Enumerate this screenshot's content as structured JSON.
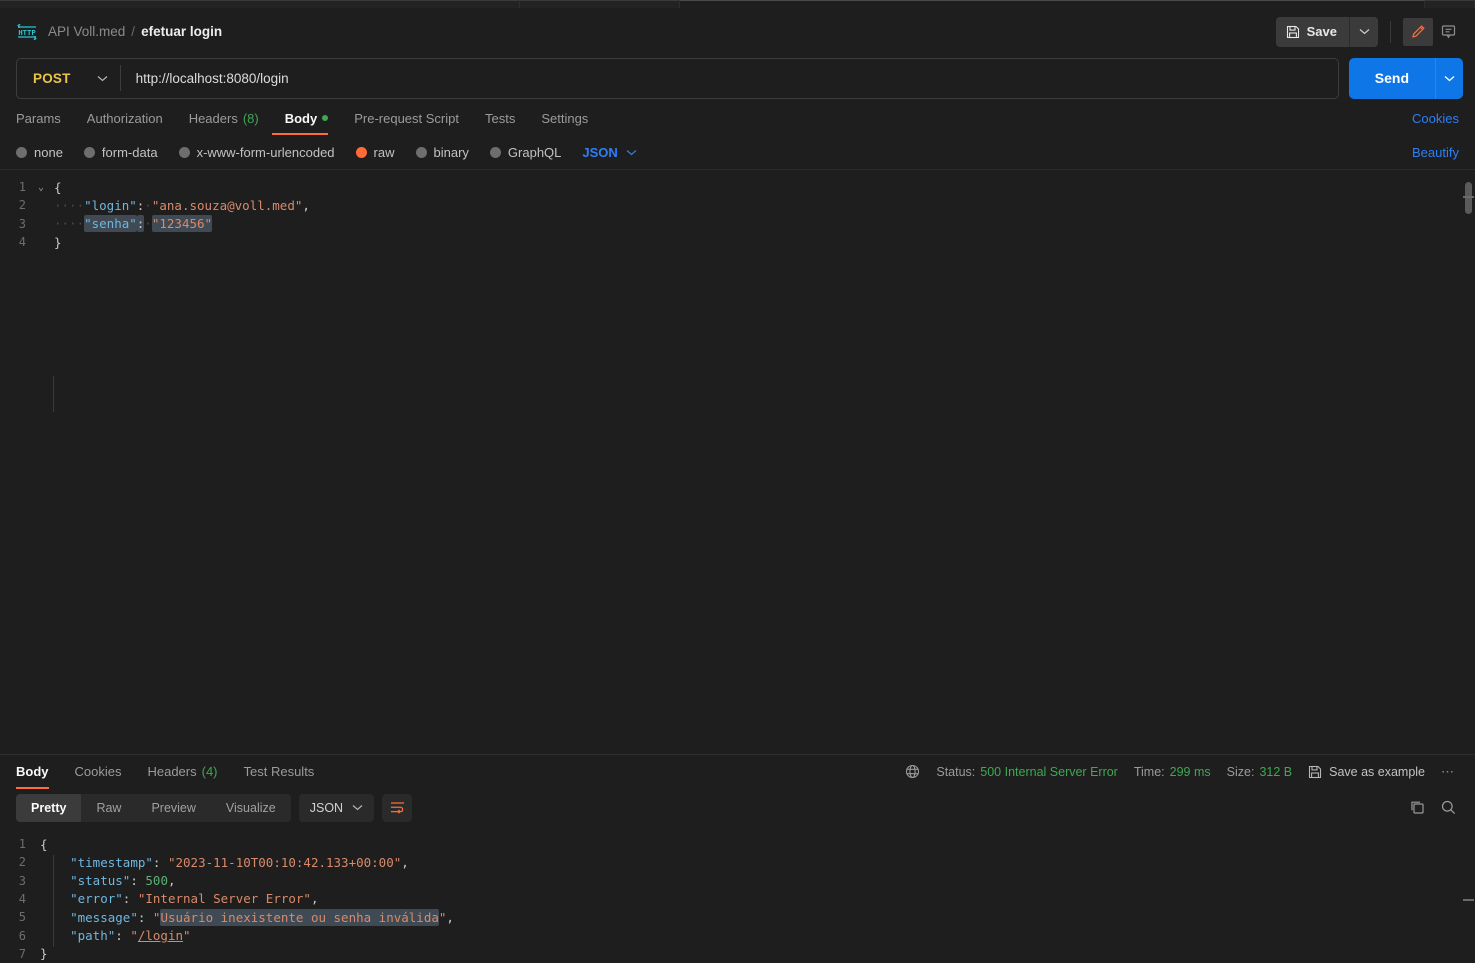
{
  "window": {
    "breadcrumb": {
      "icon": "http-badge-icon",
      "parent": "API Voll.med",
      "separator": "/",
      "current": "efetuar login"
    },
    "save_label": "Save",
    "save_icon": "floppy-disk-icon",
    "save_caret_icon": "chevron-down-icon",
    "edit_icon": "pencil-icon",
    "comment_icon": "comment-icon"
  },
  "request": {
    "method": "POST",
    "method_caret_icon": "chevron-down-icon",
    "url": "http://localhost:8080/login",
    "send_label": "Send",
    "send_caret_icon": "chevron-down-icon",
    "tabs": [
      {
        "label": "Params",
        "count": "",
        "active": false,
        "dot": false
      },
      {
        "label": "Authorization",
        "count": "",
        "active": false,
        "dot": false
      },
      {
        "label": "Headers",
        "count": "(8)",
        "active": false,
        "dot": false
      },
      {
        "label": "Body",
        "count": "",
        "active": true,
        "dot": true
      },
      {
        "label": "Pre-request Script",
        "count": "",
        "active": false,
        "dot": false
      },
      {
        "label": "Tests",
        "count": "",
        "active": false,
        "dot": false
      },
      {
        "label": "Settings",
        "count": "",
        "active": false,
        "dot": false
      }
    ],
    "cookies_link": "Cookies",
    "beautify_link": "Beautify",
    "body_types": [
      {
        "label": "none",
        "selected": false
      },
      {
        "label": "form-data",
        "selected": false
      },
      {
        "label": "x-www-form-urlencoded",
        "selected": false
      },
      {
        "label": "raw",
        "selected": true
      },
      {
        "label": "binary",
        "selected": false
      },
      {
        "label": "GraphQL",
        "selected": false
      }
    ],
    "raw_format": "JSON",
    "raw_format_caret_icon": "chevron-down-icon",
    "body_lines": [
      {
        "no": "1",
        "fold": "⌄",
        "tokens": [
          {
            "t": "p",
            "v": "{"
          }
        ]
      },
      {
        "no": "2",
        "fold": "",
        "tokens": [
          {
            "t": "ind",
            "v": "····"
          },
          {
            "t": "k",
            "v": "\"login\""
          },
          {
            "t": "p",
            "v": ":"
          },
          {
            "t": "ind",
            "v": "·"
          },
          {
            "t": "s",
            "v": "\"ana.souza@voll.med\""
          },
          {
            "t": "p",
            "v": ","
          }
        ]
      },
      {
        "no": "3",
        "fold": "",
        "selected": true,
        "tokens": [
          {
            "t": "ind",
            "v": "····"
          },
          {
            "t": "k",
            "v": "\"senha\""
          },
          {
            "t": "p",
            "v": ":"
          },
          {
            "t": "ind",
            "v": "·"
          },
          {
            "t": "s",
            "v": "\"123456\""
          }
        ]
      },
      {
        "no": "4",
        "fold": "",
        "tokens": [
          {
            "t": "p",
            "v": "}"
          }
        ]
      }
    ]
  },
  "response": {
    "tabs": [
      {
        "label": "Body",
        "count": "",
        "active": true
      },
      {
        "label": "Cookies",
        "count": "",
        "active": false
      },
      {
        "label": "Headers",
        "count": "(4)",
        "active": false
      },
      {
        "label": "Test Results",
        "count": "",
        "active": false
      }
    ],
    "globe_icon": "globe-icon",
    "status_label": "Status:",
    "status_value": "500 Internal Server Error",
    "time_label": "Time:",
    "time_value": "299 ms",
    "size_label": "Size:",
    "size_value": "312 B",
    "save_example_label": "Save as example",
    "save_example_icon": "floppy-disk-icon",
    "more_icon": "ellipsis-icon",
    "view_modes": [
      {
        "label": "Pretty",
        "active": true
      },
      {
        "label": "Raw",
        "active": false
      },
      {
        "label": "Preview",
        "active": false
      },
      {
        "label": "Visualize",
        "active": false
      }
    ],
    "format": "JSON",
    "format_caret_icon": "chevron-down-icon",
    "wrap_icon": "word-wrap-icon",
    "copy_icon": "copy-icon",
    "search_icon": "search-icon",
    "body_lines": [
      {
        "no": "1",
        "tokens": [
          {
            "t": "p",
            "v": "{"
          }
        ]
      },
      {
        "no": "2",
        "tokens": [
          {
            "t": "ind",
            "v": "    "
          },
          {
            "t": "k",
            "v": "\"timestamp\""
          },
          {
            "t": "p",
            "v": ": "
          },
          {
            "t": "s",
            "v": "\"2023-11-10T00:10:42.133+00:00\""
          },
          {
            "t": "p",
            "v": ","
          }
        ]
      },
      {
        "no": "3",
        "tokens": [
          {
            "t": "ind",
            "v": "    "
          },
          {
            "t": "k",
            "v": "\"status\""
          },
          {
            "t": "p",
            "v": ": "
          },
          {
            "t": "n",
            "v": "500"
          },
          {
            "t": "p",
            "v": ","
          }
        ]
      },
      {
        "no": "4",
        "tokens": [
          {
            "t": "ind",
            "v": "    "
          },
          {
            "t": "k",
            "v": "\"error\""
          },
          {
            "t": "p",
            "v": ": "
          },
          {
            "t": "s",
            "v": "\"Internal Server Error\""
          },
          {
            "t": "p",
            "v": ","
          }
        ]
      },
      {
        "no": "5",
        "tokens": [
          {
            "t": "ind",
            "v": "    "
          },
          {
            "t": "k",
            "v": "\"message\""
          },
          {
            "t": "p",
            "v": ": "
          },
          {
            "t": "s",
            "v": "\""
          },
          {
            "t": "s sel",
            "v": "Usuário inexistente ou senha inválida"
          },
          {
            "t": "s",
            "v": "\""
          },
          {
            "t": "p",
            "v": ","
          }
        ]
      },
      {
        "no": "6",
        "tokens": [
          {
            "t": "ind",
            "v": "    "
          },
          {
            "t": "k",
            "v": "\"path\""
          },
          {
            "t": "p",
            "v": ": "
          },
          {
            "t": "s",
            "v": "\""
          },
          {
            "t": "s uline",
            "v": "/login"
          },
          {
            "t": "s",
            "v": "\""
          }
        ]
      },
      {
        "no": "7",
        "tokens": [
          {
            "t": "p",
            "v": "}"
          }
        ]
      }
    ]
  },
  "colors": {
    "accent_orange": "#ff6c37",
    "link_blue": "#2d7ff9",
    "send_blue": "#0f76e8",
    "status_green": "#3ea853",
    "method_yellow": "#e8c547",
    "key_blue": "#6fb7e0",
    "string_salmon": "#d98a6a"
  }
}
